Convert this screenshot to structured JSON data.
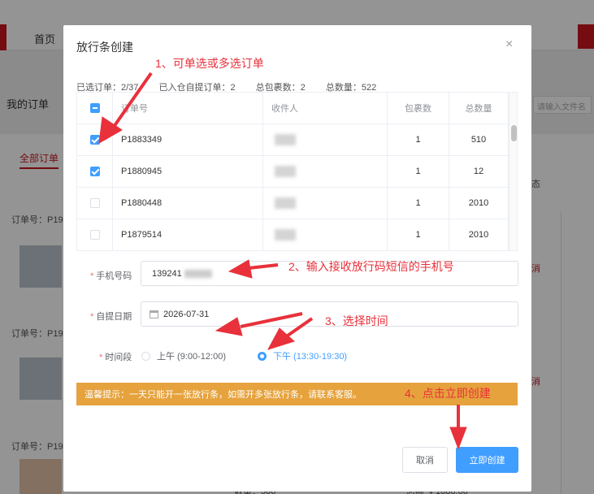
{
  "background": {
    "nav": {
      "home_label": "首页"
    },
    "my_orders_label": "我的订单",
    "all_orders_tab": "全部订单",
    "file_search_placeholder": "请输入文件名",
    "order_number_prefix": "订单号：P19",
    "cancel_label": "消",
    "right_fragment": "态",
    "bottom_quantity": "数量：500",
    "bottom_total": "总额 ￥1686.00"
  },
  "dialog": {
    "title": "放行条创建",
    "close_icon": "close-icon",
    "stats": {
      "selected": "已选订单：2/37",
      "self_pickup": "已入仓自提订单：2",
      "packages": "总包裹数：2",
      "quantity": "总数量：522"
    },
    "table": {
      "headers": [
        "订单号",
        "收件人",
        "包裹数",
        "总数量"
      ],
      "rows": [
        {
          "order": "P1883349",
          "packages": "1",
          "quantity": "510",
          "checked": true
        },
        {
          "order": "P1880945",
          "packages": "1",
          "quantity": "12",
          "checked": true
        },
        {
          "order": "P1880448",
          "packages": "1",
          "quantity": "2010",
          "checked": false
        },
        {
          "order": "P1879514",
          "packages": "1",
          "quantity": "2010",
          "checked": false
        }
      ]
    },
    "form": {
      "phone_label": "手机号码",
      "phone_value": "139241",
      "date_label": "自提日期",
      "date_value": "2026-07-31",
      "time_label": "时间段",
      "morning_option": "上午 (9:00-12:00)",
      "afternoon_option": "下午 (13:30-19:30)",
      "selected_option": "afternoon"
    },
    "tip": "温馨提示：一天只能开一张放行条，如需开多张放行条，请联系客服。",
    "cancel_button": "取消",
    "create_button": "立即创建"
  },
  "annotations": {
    "step1": "1、可单选或多选订单",
    "step2": "2、输入接收放行码短信的手机号",
    "step3": "3、选择时间",
    "step4": "4、点击立即创建",
    "color": "#e8313b"
  },
  "colors": {
    "primary": "#409eff",
    "warning": "#e6a23c",
    "brand_red": "#c8161e"
  }
}
